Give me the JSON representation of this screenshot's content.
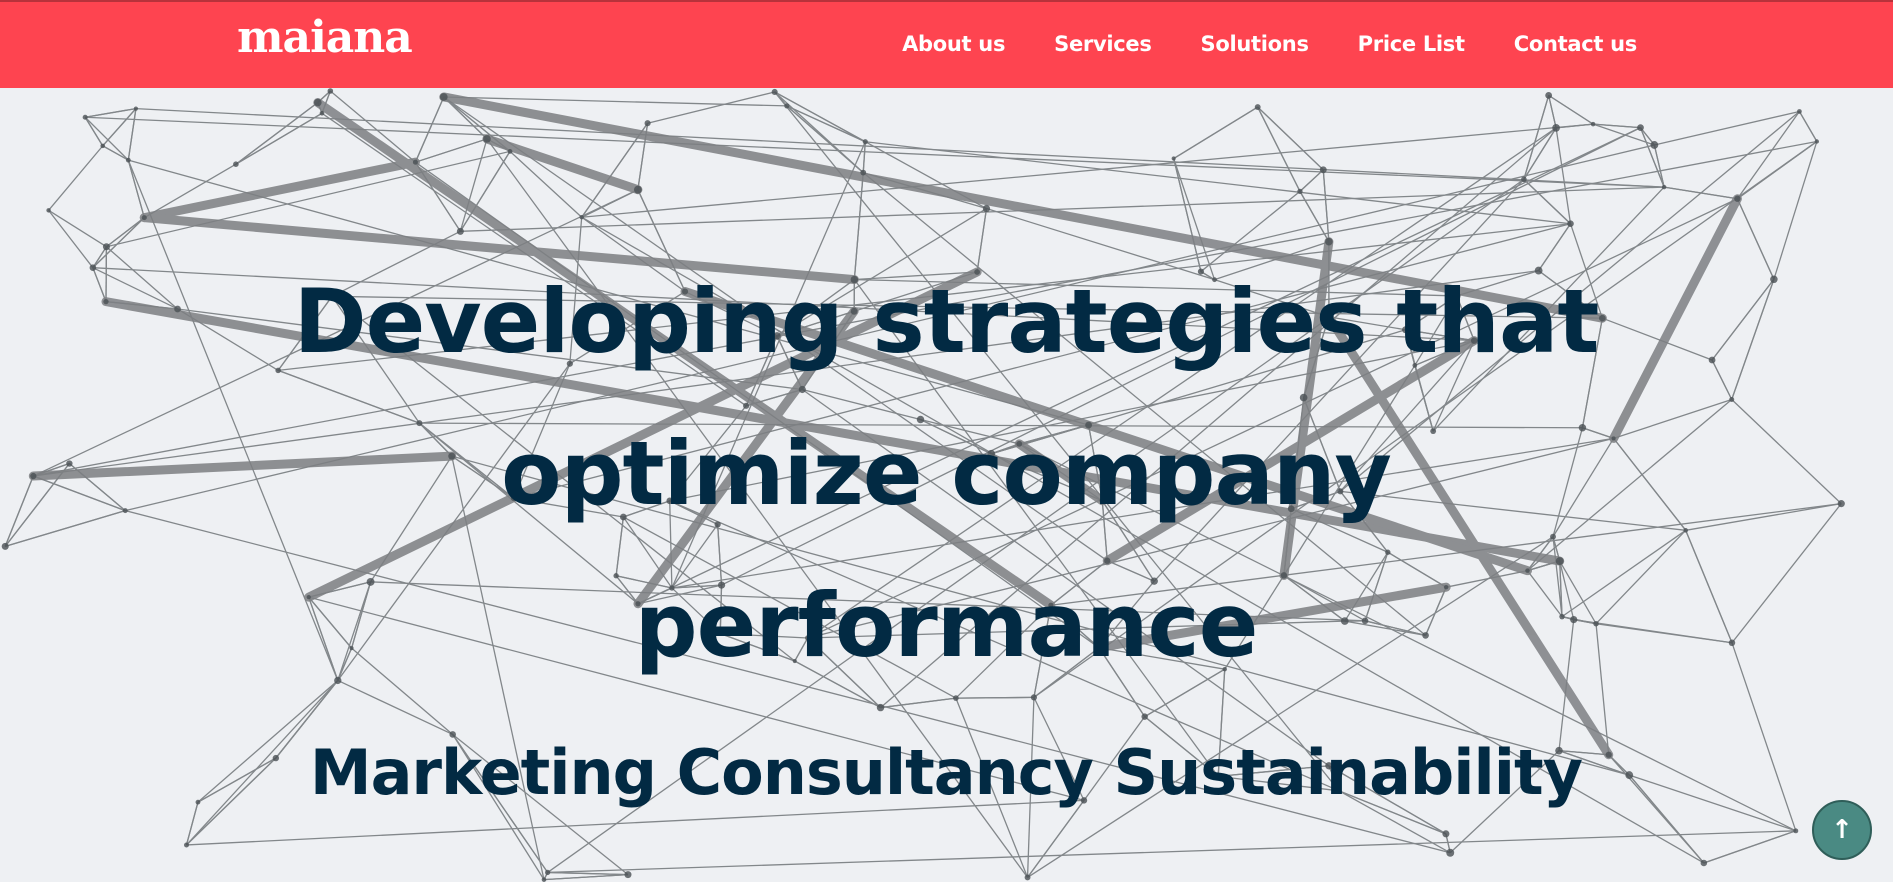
{
  "header": {
    "logo": "maiana",
    "nav": [
      {
        "label": "About us"
      },
      {
        "label": "Services"
      },
      {
        "label": "Solutions"
      },
      {
        "label": "Price List"
      },
      {
        "label": "Contact us"
      }
    ]
  },
  "hero": {
    "headline_lines": [
      "Developing strategies that",
      "optimize company",
      "performance"
    ],
    "subheadline": "Marketing Consultancy Sustainability",
    "background_image": "network of lines and nodes"
  },
  "back_to_top": {
    "icon": "arrow-up-icon",
    "glyph": "↑"
  },
  "colors": {
    "header_bg": "#fe4450",
    "text_dark": "#022a43",
    "button_teal": "#4a8a83",
    "hero_bg": "#eef0f3"
  }
}
